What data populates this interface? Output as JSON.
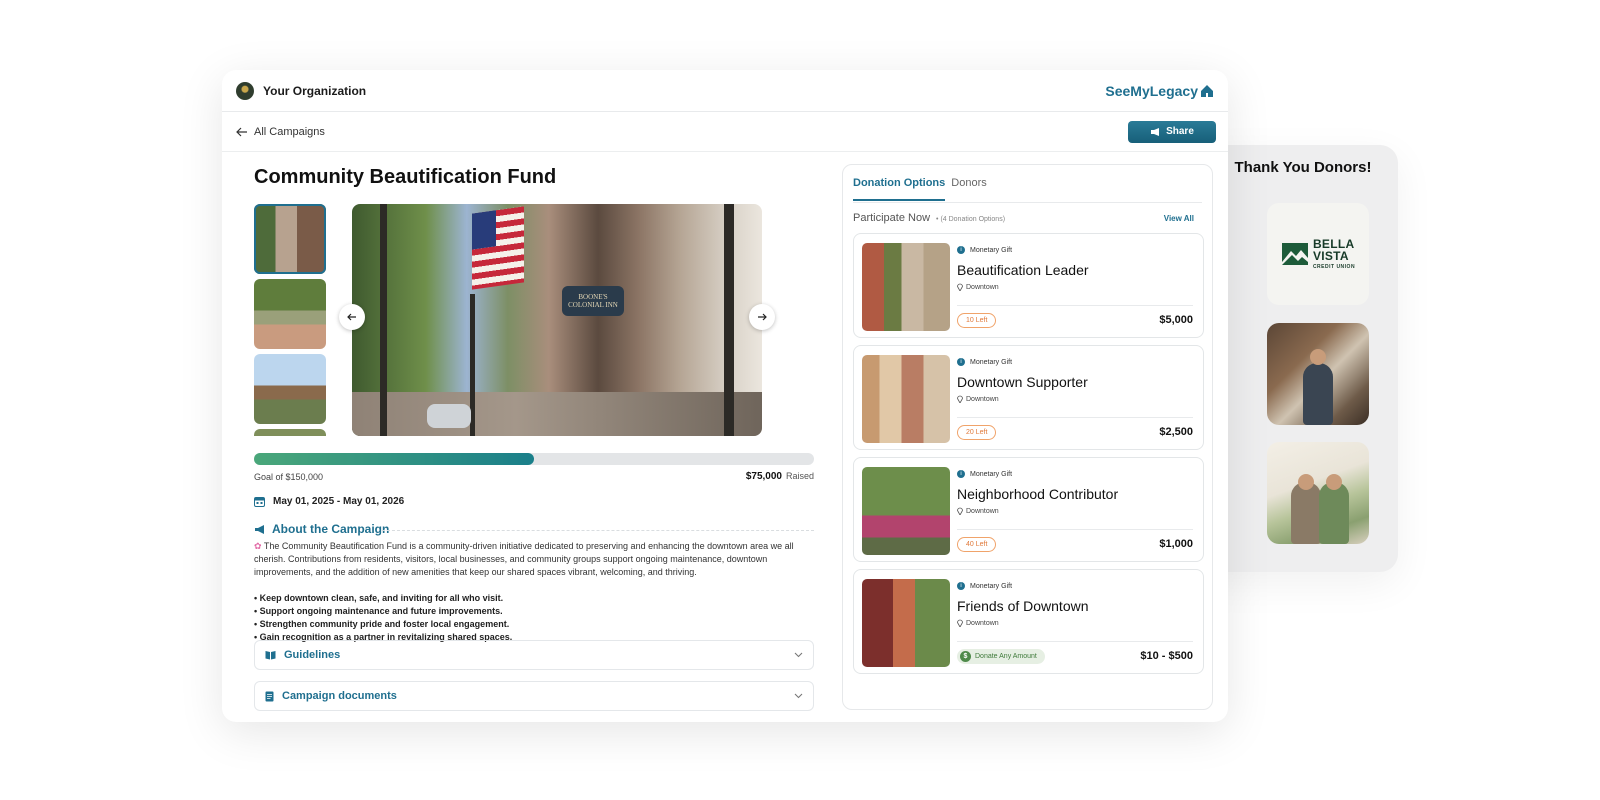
{
  "donors": {
    "title": "Thank You Donors!",
    "logo": {
      "line1": "BELLA",
      "line2": "VISTA",
      "line3": "CREDIT UNION"
    }
  },
  "header": {
    "org_name": "Your Organization",
    "brand": "SeeMyLegacy"
  },
  "subbar": {
    "back_label": "All Campaigns",
    "share_label": "Share"
  },
  "campaign": {
    "title": "Community Beautification Fund",
    "hero_sign": "BOONE'S COLONIAL INN",
    "progress_fraction": 0.5,
    "goal_label": "Goal of $150,000",
    "raised_amount": "$75,000",
    "raised_label": "Raised",
    "date_range": "May 01, 2025 - May 01, 2026",
    "about_heading": "About the Campaign",
    "about_text": "The Community Beautification Fund is a community-driven initiative dedicated to preserving and enhancing the downtown area we all cherish. Contributions from residents, visitors, local businesses, and community groups support ongoing maintenance, downtown improvements, and the addition of new amenities that keep our shared spaces vibrant, welcoming, and thriving.",
    "bullets": [
      "• Keep downtown clean, safe, and inviting for all who visit.",
      "• Support ongoing maintenance and future improvements.",
      "• Strengthen community pride and foster local engagement.",
      "• Gain recognition as a partner in revitalizing shared spaces."
    ],
    "sections": [
      {
        "label": "Guidelines"
      },
      {
        "label": "Campaign documents"
      }
    ]
  },
  "donation": {
    "tabs": [
      {
        "label": "Donation Options",
        "active": true
      },
      {
        "label": "Donors",
        "active": false
      }
    ],
    "participate_label": "Participate Now",
    "participate_count": "• (4 Donation Options)",
    "view_all": "View All",
    "options": [
      {
        "type": "Monetary Gift",
        "title": "Beautification Leader",
        "location": "Downtown",
        "badge": "10 Left",
        "price": "$5,000"
      },
      {
        "type": "Monetary Gift",
        "title": "Downtown Supporter",
        "location": "Downtown",
        "badge": "20 Left",
        "price": "$2,500"
      },
      {
        "type": "Monetary Gift",
        "title": "Neighborhood Contributor",
        "location": "Downtown",
        "badge": "40 Left",
        "price": "$1,000"
      },
      {
        "type": "Monetary Gift",
        "title": "Friends of Downtown",
        "location": "Downtown",
        "badge": "Donate Any Amount",
        "price": "$10 - $500"
      }
    ]
  },
  "colors": {
    "accent": "#1f6f8f",
    "progress_start": "#4aa77a",
    "progress_end": "#1a7f8a",
    "badge_orange": "#e0793a",
    "badge_green": "#3f7a3a"
  }
}
